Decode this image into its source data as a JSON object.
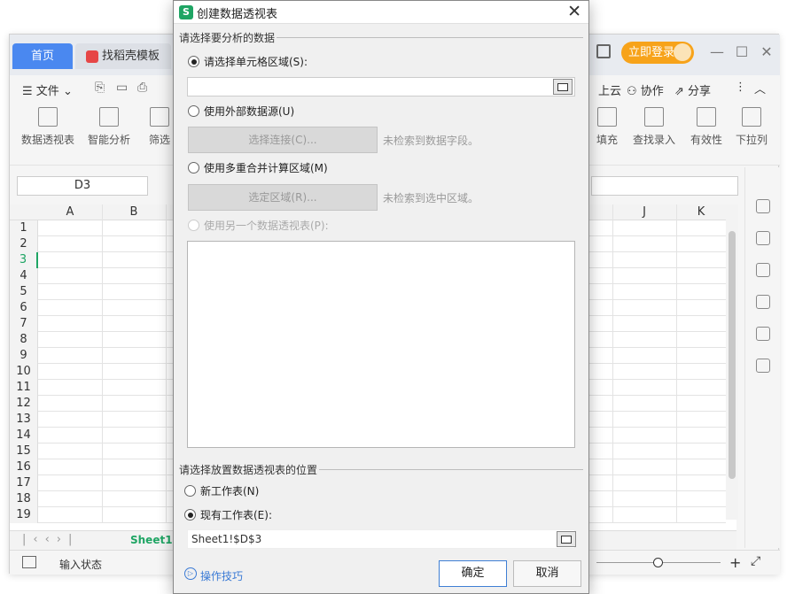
{
  "app": {
    "tabs": {
      "home": "首页",
      "template": "找稻壳模板"
    },
    "login": "立即登录",
    "toolbar": {
      "file": "文件",
      "cloud": "上云",
      "collab": "协作",
      "share": "分享"
    },
    "ribbon": {
      "pivot": "数据透视表",
      "smart": "智能分析",
      "filter": "筛选",
      "fill": "填充",
      "lookup": "查找录入",
      "validity": "有效性",
      "dropdown": "下拉列"
    },
    "namebox": "D3",
    "columns": [
      "A",
      "B",
      "J",
      "K"
    ],
    "rows": [
      "1",
      "2",
      "3",
      "4",
      "5",
      "6",
      "7",
      "8",
      "9",
      "10",
      "11",
      "12",
      "13",
      "14",
      "15",
      "16",
      "17",
      "18",
      "19"
    ],
    "sheet_tab": "Sheet1",
    "status": "输入状态"
  },
  "dialog": {
    "title": "创建数据透视表",
    "logo": "S",
    "section1": "请选择要分析的数据",
    "opt_range": "请选择单元格区域(S):",
    "opt_external": "使用外部数据源(U)",
    "btn_select_conn": "选择连接(C)...",
    "hint_no_field": "未检索到数据字段。",
    "opt_multi": "使用多重合并计算区域(M)",
    "btn_select_range": "选定区域(R)...",
    "hint_no_range": "未检索到选中区域。",
    "opt_other_pivot": "使用另一个数据透视表(P):",
    "section2": "请选择放置数据透视表的位置",
    "opt_new_sheet": "新工作表(N)",
    "opt_existing": "现有工作表(E):",
    "existing_value": "Sheet1!$D$3",
    "tips": "操作技巧",
    "ok": "确定",
    "cancel": "取消"
  }
}
